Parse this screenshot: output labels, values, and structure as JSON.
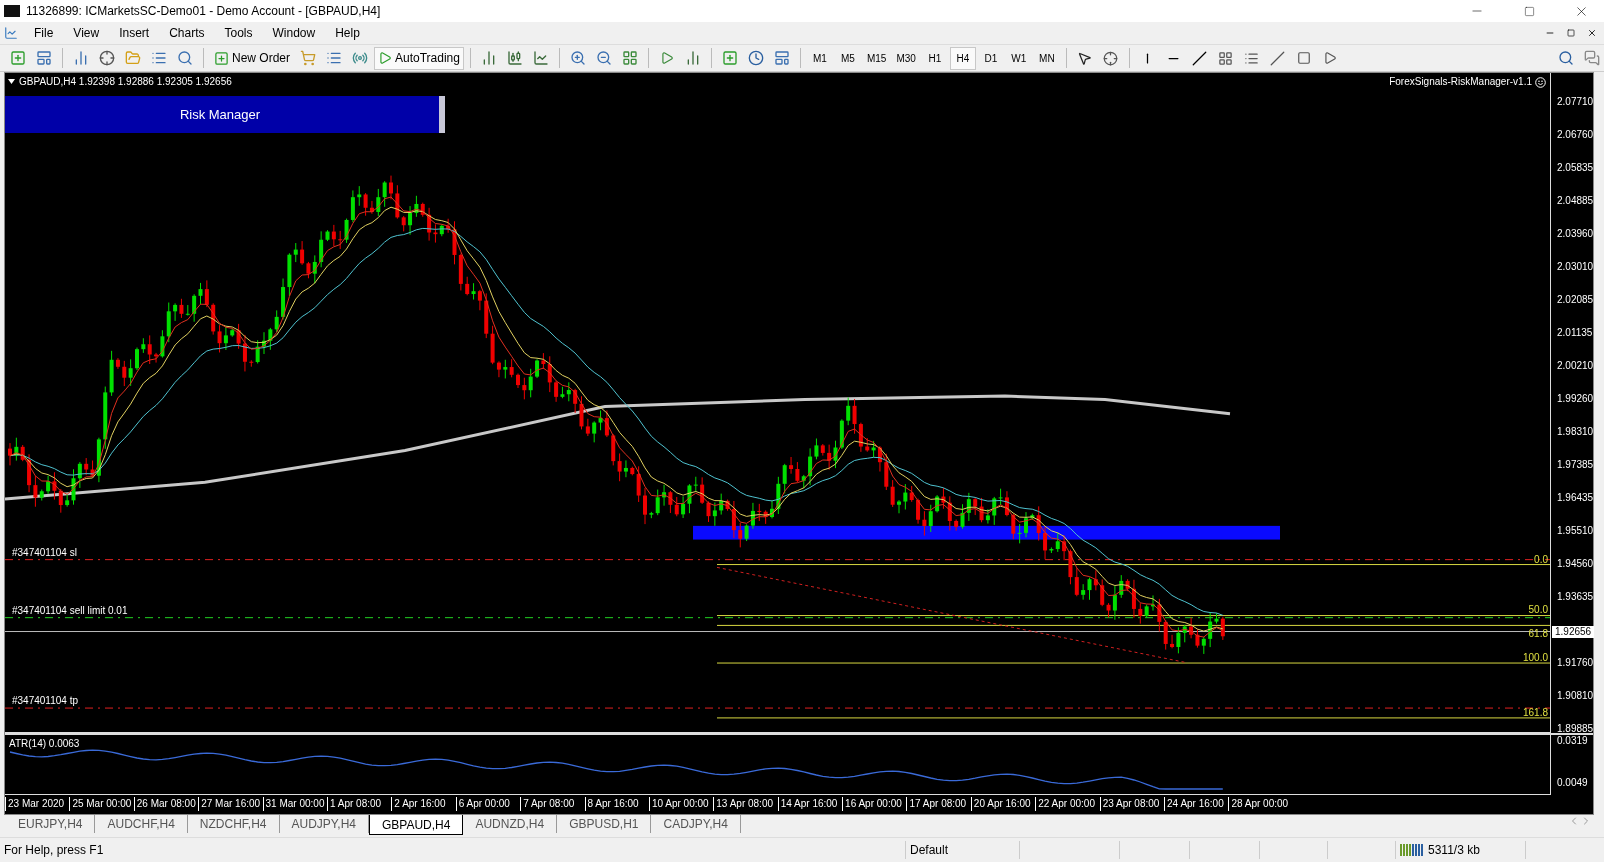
{
  "window": {
    "title": "11326899: ICMarketsSC-Demo01 - Demo Account - [GBPAUD,H4]"
  },
  "menu": [
    "File",
    "View",
    "Insert",
    "Charts",
    "Tools",
    "Window",
    "Help"
  ],
  "toolbar": {
    "new_order": "New Order",
    "autotrading": "AutoTrading",
    "timeframes": [
      {
        "label": "M1",
        "selected": false
      },
      {
        "label": "M5",
        "selected": false
      },
      {
        "label": "M15",
        "selected": false
      },
      {
        "label": "M30",
        "selected": false
      },
      {
        "label": "H1",
        "selected": false
      },
      {
        "label": "H4",
        "selected": true
      },
      {
        "label": "D1",
        "selected": false
      },
      {
        "label": "W1",
        "selected": false
      },
      {
        "label": "MN",
        "selected": false
      }
    ]
  },
  "chart": {
    "header": "GBPAUD,H4  1.92398 1.92886 1.92305 1.92656",
    "panel_title": "Risk Manager",
    "expert": "ForexSignals-RiskManager-v1.1",
    "price_ticks": [
      "2.07710",
      "2.06760",
      "2.05835",
      "2.04885",
      "2.03960",
      "2.03010",
      "2.02085",
      "2.01135",
      "2.00210",
      "1.99260",
      "1.98310",
      "1.97385",
      "1.96435",
      "1.95510",
      "1.94560",
      "1.93635",
      "1.91760",
      "1.90810",
      "1.89885"
    ],
    "current_price": "1.92656",
    "order_lines": [
      {
        "label": "#347401104 sl",
        "kind": "sl"
      },
      {
        "label": "#347401104 sell limit 0.01",
        "kind": "limit"
      },
      {
        "label": "#347401104 tp",
        "kind": "tp"
      }
    ],
    "fib_levels": [
      "0.0",
      "50.0",
      "61.8",
      "100.0",
      "161.8"
    ],
    "indicator": {
      "label": "ATR(14) 0.0063",
      "ticks": [
        "0.0319",
        "0.0049"
      ]
    },
    "time_labels": [
      "23 Mar 2020",
      "25 Mar 00:00",
      "26 Mar 08:00",
      "27 Mar 16:00",
      "31 Mar 00:00",
      "1 Apr 08:00",
      "2 Apr 16:00",
      "6 Apr 00:00",
      "7 Apr 08:00",
      "8 Apr 16:00",
      "10 Apr 00:00",
      "13 Apr 08:00",
      "14 Apr 16:00",
      "16 Apr 00:00",
      "17 Apr 08:00",
      "20 Apr 16:00",
      "22 Apr 00:00",
      "23 Apr 08:00",
      "24 Apr 16:00",
      "28 Apr 00:00"
    ]
  },
  "tabs": [
    {
      "label": "EURJPY,H4",
      "selected": false
    },
    {
      "label": "AUDCHF,H4",
      "selected": false
    },
    {
      "label": "NZDCHF,H4",
      "selected": false
    },
    {
      "label": "AUDJPY,H4",
      "selected": false
    },
    {
      "label": "GBPAUD,H4",
      "selected": true
    },
    {
      "label": "AUDNZD,H4",
      "selected": false
    },
    {
      "label": "GBPUSD,H1",
      "selected": false
    },
    {
      "label": "CADJPY,H4",
      "selected": false
    }
  ],
  "status_bar": {
    "help": "For Help, press F1",
    "profile": "Default",
    "traffic": "5311/3 kb"
  }
}
